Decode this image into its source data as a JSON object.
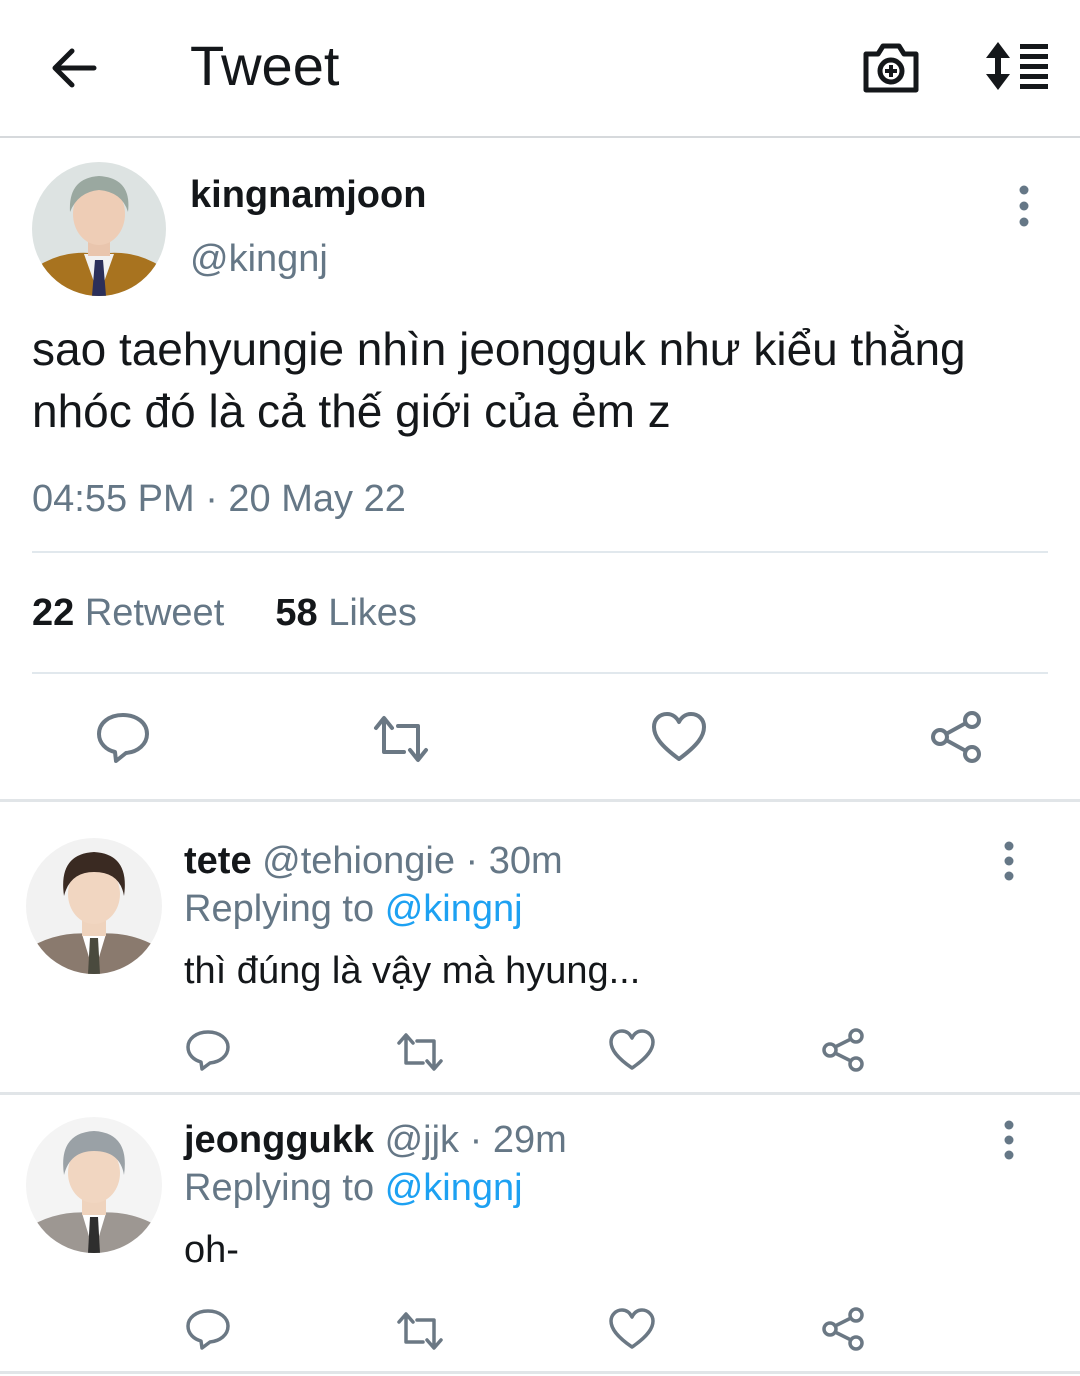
{
  "header": {
    "title": "Tweet"
  },
  "tweet": {
    "name": "kingnamjoon",
    "handle": "@kingnj",
    "text": "sao taehyungie nhìn jeongguk như kiểu thằng nhóc đó là cả thế giới của ẻm z",
    "time": "04:55 PM · 20 May 22",
    "retweets": "22",
    "retweet_label": "Retweet",
    "likes": "58",
    "likes_label": "Likes"
  },
  "replies": [
    {
      "name": "tete",
      "handle": "@tehiongie",
      "time": "· 30m",
      "replying_label": "Replying to",
      "replying_to": "@kingnj",
      "text": "thì đúng là vậy mà hyung..."
    },
    {
      "name": "jeonggukk",
      "handle": "@jjk",
      "time": "· 29m",
      "replying_label": "Replying to",
      "replying_to": "@kingnj",
      "text": "oh-"
    }
  ],
  "icons": {
    "back": "arrow-left-icon",
    "camera": "camera-add-icon",
    "sort": "sort-icon",
    "reply": "comment-icon",
    "retweet": "retweet-icon",
    "like": "heart-icon",
    "share": "share-icon",
    "more": "more-vertical-icon"
  },
  "colors": {
    "accent": "#1da1f2",
    "muted": "#657786",
    "text": "#14171a",
    "icon": "#6b7884"
  }
}
